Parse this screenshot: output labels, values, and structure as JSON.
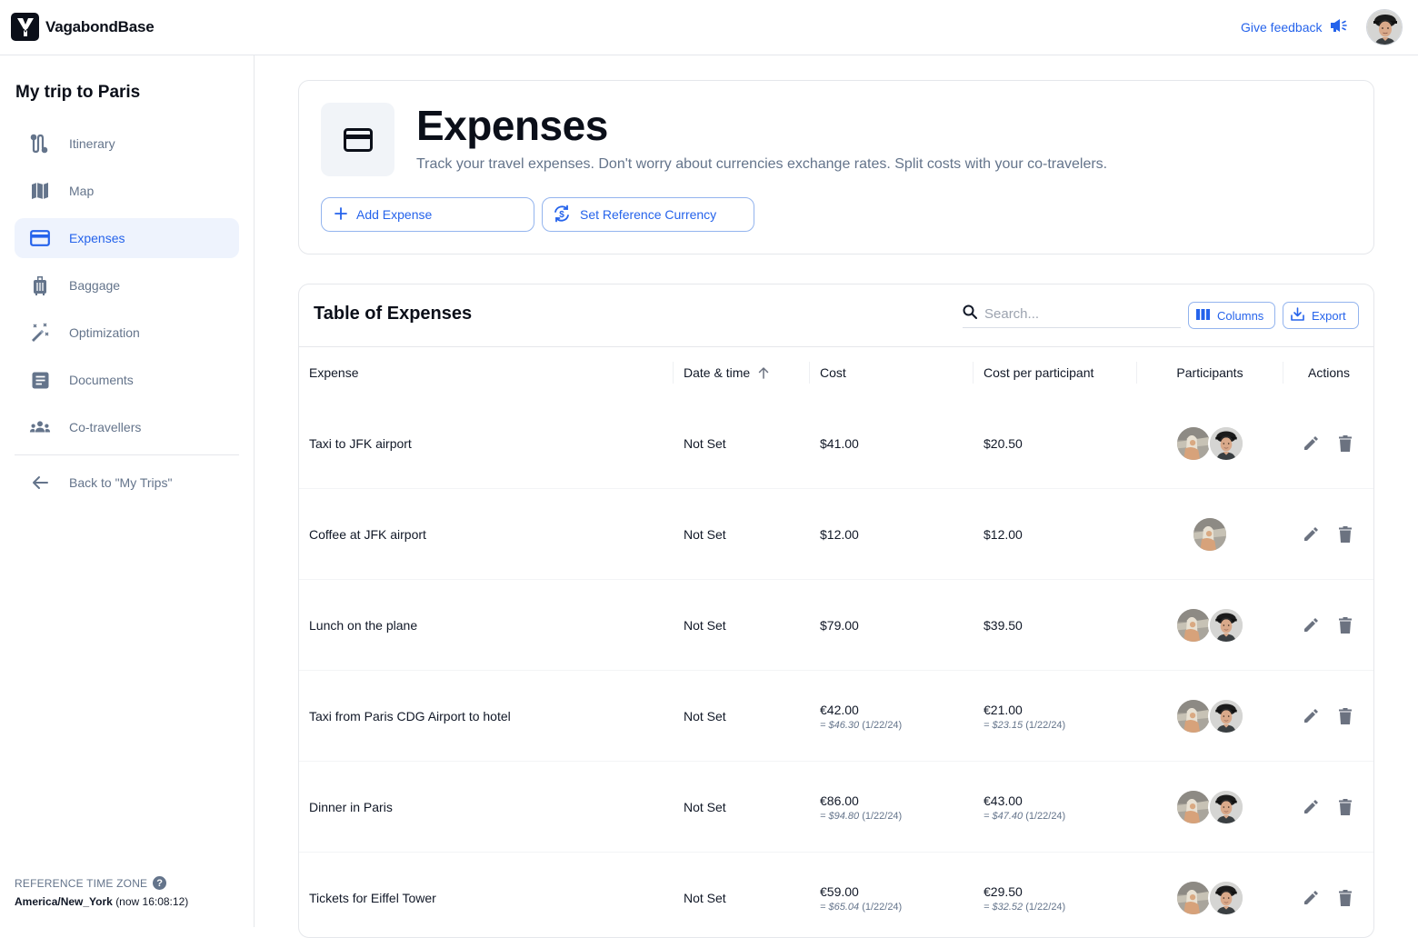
{
  "app": {
    "brand": "VagabondBase",
    "feedback_label": "Give feedback"
  },
  "sidebar": {
    "trip_title": "My trip to Paris",
    "items": [
      {
        "label": "Itinerary",
        "icon": "route-icon",
        "active": false
      },
      {
        "label": "Map",
        "icon": "map-icon",
        "active": false
      },
      {
        "label": "Expenses",
        "icon": "credit-card-icon",
        "active": true
      },
      {
        "label": "Baggage",
        "icon": "luggage-icon",
        "active": false
      },
      {
        "label": "Optimization",
        "icon": "magic-wand-icon",
        "active": false
      },
      {
        "label": "Documents",
        "icon": "document-icon",
        "active": false
      },
      {
        "label": "Co-travellers",
        "icon": "group-icon",
        "active": false
      }
    ],
    "back_label": "Back to \"My Trips\"",
    "timezone": {
      "label": "REFERENCE TIME ZONE",
      "zone": "America/New_York",
      "now": "(now 16:08:12)"
    }
  },
  "header": {
    "title": "Expenses",
    "subtitle": "Track your travel expenses. Don't worry about currencies exchange rates. Split costs with your co-travelers.",
    "add_button": "Add Expense",
    "currency_button": "Set Reference Currency"
  },
  "table": {
    "title": "Table of Expenses",
    "search_placeholder": "Search...",
    "search_value": "",
    "columns_button": "Columns",
    "export_button": "Export",
    "columns": [
      "Expense",
      "Date & time",
      "Cost",
      "Cost per participant",
      "Participants",
      "Actions"
    ],
    "sort": {
      "column": "Date & time",
      "direction": "ascending"
    },
    "rows": [
      {
        "expense": "Taxi to JFK airport",
        "date": "Not Set",
        "cost": "$41.00",
        "cost_conv": "",
        "cost_conv_date": "",
        "per": "$20.50",
        "per_conv": "",
        "per_conv_date": "",
        "participants": [
          "Traveler A",
          "Traveler B"
        ]
      },
      {
        "expense": "Coffee at JFK airport",
        "date": "Not Set",
        "cost": "$12.00",
        "cost_conv": "",
        "cost_conv_date": "",
        "per": "$12.00",
        "per_conv": "",
        "per_conv_date": "",
        "participants": [
          "Traveler A"
        ]
      },
      {
        "expense": "Lunch on the plane",
        "date": "Not Set",
        "cost": "$79.00",
        "cost_conv": "",
        "cost_conv_date": "",
        "per": "$39.50",
        "per_conv": "",
        "per_conv_date": "",
        "participants": [
          "Traveler A",
          "Traveler B"
        ]
      },
      {
        "expense": "Taxi from Paris CDG Airport to hotel",
        "date": "Not Set",
        "cost": "€42.00",
        "cost_conv": "= $46.30",
        "cost_conv_date": "(1/22/24)",
        "per": "€21.00",
        "per_conv": "= $23.15",
        "per_conv_date": "(1/22/24)",
        "participants": [
          "Traveler A",
          "Traveler B"
        ]
      },
      {
        "expense": "Dinner in Paris",
        "date": "Not Set",
        "cost": "€86.00",
        "cost_conv": "= $94.80",
        "cost_conv_date": "(1/22/24)",
        "per": "€43.00",
        "per_conv": "= $47.40",
        "per_conv_date": "(1/22/24)",
        "participants": [
          "Traveler A",
          "Traveler B"
        ]
      },
      {
        "expense": "Tickets for Eiffel Tower",
        "date": "Not Set",
        "cost": "€59.00",
        "cost_conv": "= $65.04",
        "cost_conv_date": "(1/22/24)",
        "per": "€29.50",
        "per_conv": "= $32.52",
        "per_conv_date": "(1/22/24)",
        "participants": [
          "Traveler A",
          "Traveler B"
        ]
      }
    ]
  },
  "colors": {
    "accent": "#2563eb",
    "active_bg": "#eef3fd",
    "muted_text": "#64748b",
    "border": "#e5e7eb",
    "icon_gray": "#6b7280"
  }
}
